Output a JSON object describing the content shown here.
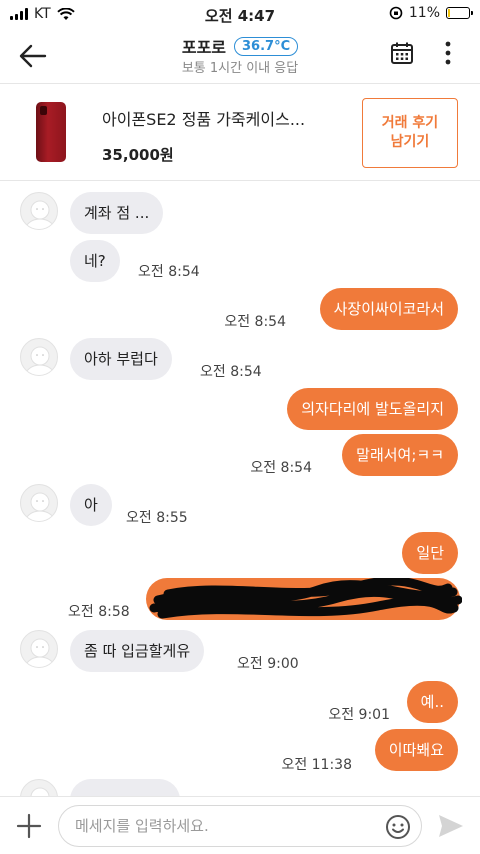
{
  "status": {
    "carrier": "KT",
    "time": "오전 4:47",
    "battery": "11%",
    "battery_level": 0.11
  },
  "header": {
    "title": "포포로",
    "temperature": "36.7°C",
    "subtitle": "보통 1시간 이내 응답"
  },
  "product": {
    "name": "아이폰SE2 정품 가죽케이스...",
    "price": "35,000원",
    "review_button": "거래 후기\n남기기"
  },
  "messages": [
    {
      "side": "in",
      "text": "계좌 점 ...",
      "time": ""
    },
    {
      "side": "in",
      "text": "네?",
      "time": "오전 8:54"
    },
    {
      "side": "out",
      "text": "사장이싸이코라서",
      "time": "오전 8:54"
    },
    {
      "side": "in",
      "text": "아하 부럽다",
      "time": "오전 8:54"
    },
    {
      "side": "out",
      "text": "의자다리에 발도올리지",
      "time": ""
    },
    {
      "side": "out",
      "text": "말래서여;ㅋㅋ",
      "time": "오전 8:54"
    },
    {
      "side": "in",
      "text": "아",
      "time": "오전 8:55"
    },
    {
      "side": "out",
      "text": "일단",
      "time": ""
    },
    {
      "side": "out",
      "text": "",
      "time": "오전 8:58",
      "redacted": true
    },
    {
      "side": "in",
      "text": "좀 따 입금할게유",
      "time": "오전 9:00"
    },
    {
      "side": "out",
      "text": "예..",
      "time": "오전 9:01"
    },
    {
      "side": "out",
      "text": "이따봬요",
      "time": "오전 11:38"
    }
  ],
  "input": {
    "placeholder": "메세지를 입력하세요."
  },
  "colors": {
    "accent": "#f07a3a",
    "temp_badge": "#2d8ed6",
    "incoming_bubble": "#ececf0"
  }
}
